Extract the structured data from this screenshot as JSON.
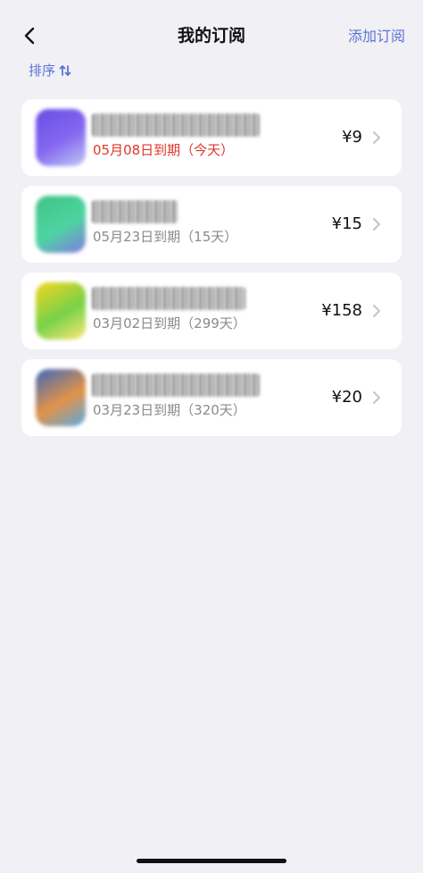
{
  "nav": {
    "title": "我的订阅",
    "add_label": "添加订阅",
    "back_icon": "chevron-left-icon"
  },
  "sort": {
    "label": "排序",
    "icon": "sort-arrows-icon"
  },
  "subscriptions": [
    {
      "expiry": "05月08日到期（今天）",
      "price": "¥9",
      "status": "today",
      "icon_colors": [
        "#5b3fe0",
        "#7c5cf0",
        "#b9c7f5"
      ]
    },
    {
      "expiry": "05月23日到期（15天）",
      "price": "¥15",
      "status": "normal",
      "icon_colors": [
        "#2fbf7a",
        "#3fd19a",
        "#7a6fe0"
      ]
    },
    {
      "expiry": "03月02日到期（299天）",
      "price": "¥158",
      "status": "normal",
      "icon_colors": [
        "#f5d20a",
        "#6ccf3a",
        "#ffe56b"
      ]
    },
    {
      "expiry": "03月23日到期（320天）",
      "price": "¥20",
      "status": "normal",
      "icon_colors": [
        "#2b5bb5",
        "#e08a3a",
        "#4aa3e0"
      ]
    }
  ],
  "colors": {
    "accent": "#5b73d6",
    "today": "#e0362c",
    "muted": "#8a8a8e",
    "background": "#f0f0f5"
  }
}
